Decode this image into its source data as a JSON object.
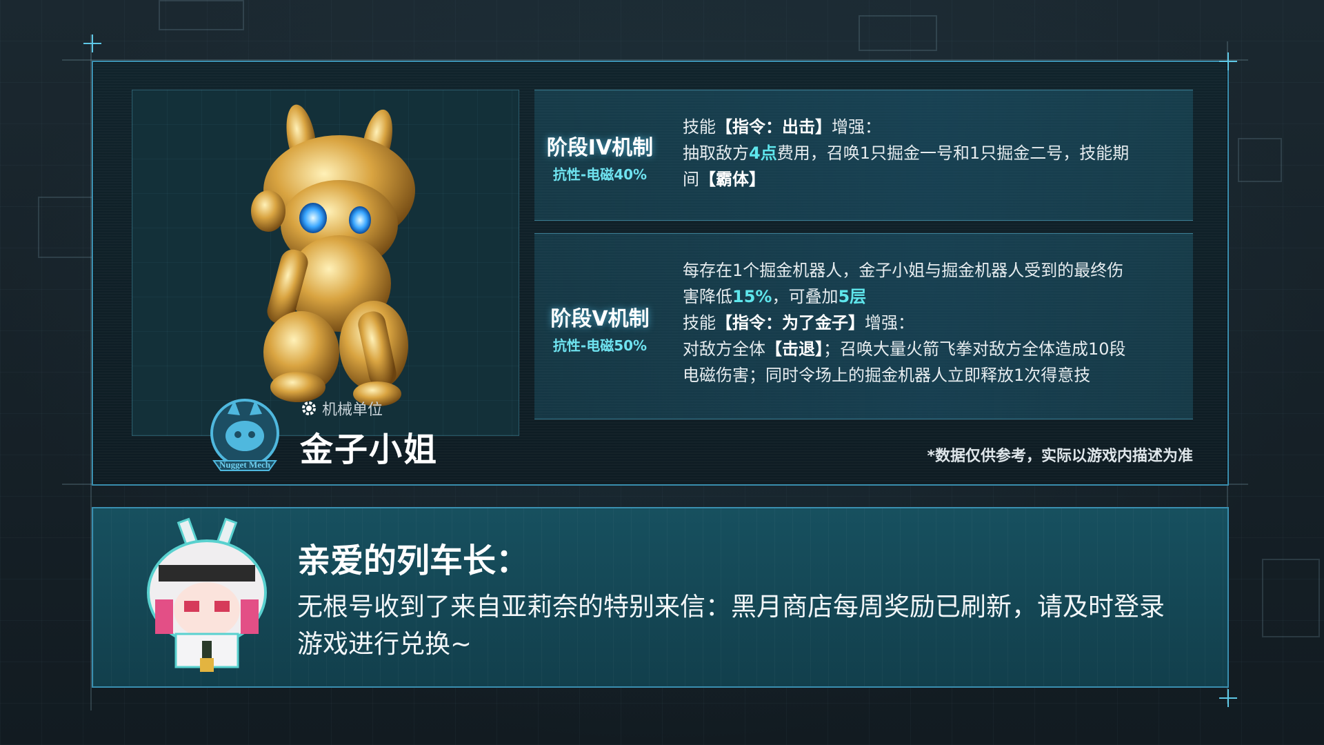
{
  "character": {
    "emblem_text": "Nugget Mech",
    "unit_type": "机械单位",
    "name": "金子小姐"
  },
  "stages": [
    {
      "title": "阶段IV机制",
      "resist": "抗性-电磁40%",
      "lines": {
        "l1a": "技能",
        "l1b": "【指令：出击】",
        "l1c": "增强：",
        "l2a": "抽取敌方",
        "l2b": "4点",
        "l2c": "费用，召唤1只掘金一号和1只掘金二号，技能期",
        "l3a": "间",
        "l3b": "【霸体】"
      }
    },
    {
      "title": "阶段V机制",
      "resist": "抗性-电磁50%",
      "lines": {
        "l1": "每存在1个掘金机器人，金子小姐与掘金机器人受到的最终伤",
        "l2a": "害降低",
        "l2b": "15%",
        "l2c": "，可叠加",
        "l2d": "5层",
        "l3a": "技能",
        "l3b": "【指令：为了金子】",
        "l3c": "增强：",
        "l4a": "对敌方全体",
        "l4b": "【击退】",
        "l4c": "；召唤大量火箭飞拳对敌方全体造成10段",
        "l5": "电磁伤害；同时令场上的掘金机器人立即释放1次得意技"
      }
    }
  ],
  "disclaimer": "*数据仅供参考，实际以游戏内描述为准",
  "notice": {
    "greeting": "亲爱的列车长：",
    "message": "无根号收到了来自亚莉奈的特别来信：黑月商店每周奖励已刷新，请及时登录游戏进行兑换~"
  },
  "colors": {
    "accent": "#5fe6ec",
    "frame": "#3a8fb0",
    "panel_bottom": "#17505f"
  }
}
